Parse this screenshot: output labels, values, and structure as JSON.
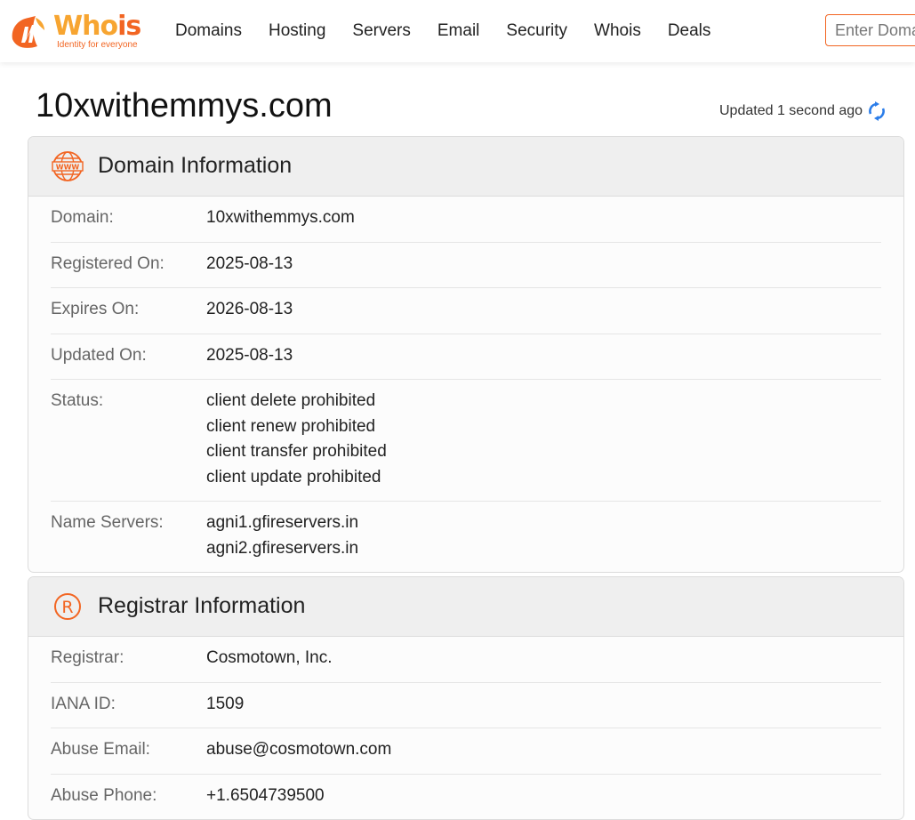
{
  "header": {
    "logo_text_main": "Who",
    "logo_text_accent": "is",
    "logo_tagline": "Identity for everyone",
    "nav": [
      "Domains",
      "Hosting",
      "Servers",
      "Email",
      "Security",
      "Whois",
      "Deals"
    ],
    "search_placeholder": "Enter Domain or IP"
  },
  "page": {
    "title": "10xwithemmys.com",
    "updated_text": "Updated 1 second ago"
  },
  "domain_info": {
    "heading": "Domain Information",
    "icon": "www-icon",
    "rows": [
      {
        "label": "Domain:",
        "values": [
          "10xwithemmys.com"
        ]
      },
      {
        "label": "Registered On:",
        "values": [
          "2025-08-13"
        ]
      },
      {
        "label": "Expires On:",
        "values": [
          "2026-08-13"
        ]
      },
      {
        "label": "Updated On:",
        "values": [
          "2025-08-13"
        ]
      },
      {
        "label": "Status:",
        "values": [
          "client delete prohibited",
          "client renew prohibited",
          "client transfer prohibited",
          "client update prohibited"
        ]
      },
      {
        "label": "Name Servers:",
        "values": [
          "agni1.gfireservers.in",
          "agni2.gfireservers.in"
        ]
      }
    ]
  },
  "registrar_info": {
    "heading": "Registrar Information",
    "icon": "registered-icon",
    "rows": [
      {
        "label": "Registrar:",
        "values": [
          "Cosmotown, Inc."
        ]
      },
      {
        "label": "IANA ID:",
        "values": [
          "1509"
        ]
      },
      {
        "label": "Abuse Email:",
        "values": [
          "abuse@cosmotown.com"
        ]
      },
      {
        "label": "Abuse Phone:",
        "values": [
          "+1.6504739500"
        ]
      }
    ]
  },
  "colors": {
    "brand_orange": "#f26522",
    "brand_yellow": "#f7a531",
    "refresh_blue": "#2b7de9"
  }
}
